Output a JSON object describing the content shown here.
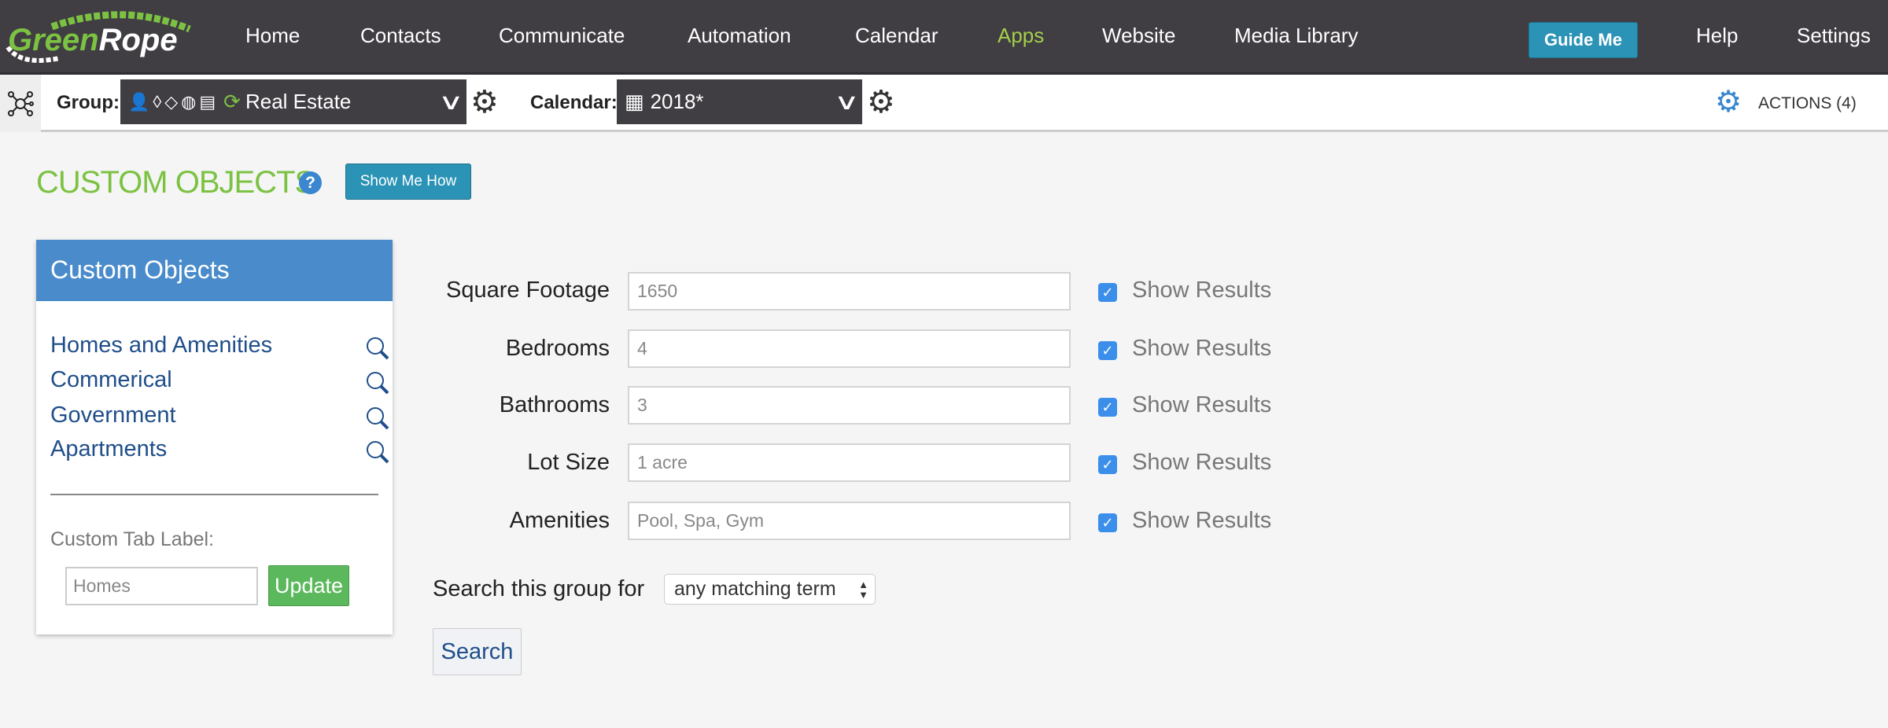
{
  "brand": {
    "logo_text": "GreenRope",
    "accent": "#7cc242"
  },
  "nav": {
    "items": [
      {
        "label": "Home"
      },
      {
        "label": "Contacts"
      },
      {
        "label": "Communicate"
      },
      {
        "label": "Automation"
      },
      {
        "label": "Calendar"
      },
      {
        "label": "Apps",
        "active": true
      },
      {
        "label": "Website"
      },
      {
        "label": "Media Library"
      }
    ],
    "guide_me": "Guide Me",
    "help": "Help",
    "settings": "Settings"
  },
  "toolbar": {
    "group_label": "Group:",
    "group_value": "Real Estate",
    "calendar_label": "Calendar:",
    "calendar_value": "2018*",
    "actions": "ACTIONS (4)"
  },
  "page": {
    "title": "CUSTOM OBJECTS",
    "help_icon": "?",
    "show_me_how": "Show Me How"
  },
  "panel": {
    "title": "Custom Objects",
    "items": [
      {
        "label": "Homes and Amenities"
      },
      {
        "label": "Commerical"
      },
      {
        "label": "Government"
      },
      {
        "label": "Apartments"
      }
    ],
    "tab_label": "Custom Tab Label:",
    "tab_value": "Homes",
    "update": "Update"
  },
  "form": {
    "fields": [
      {
        "label": "Square Footage",
        "value": "1650",
        "show_results": "Show Results",
        "checked": true
      },
      {
        "label": "Bedrooms",
        "value": "4",
        "show_results": "Show Results",
        "checked": true
      },
      {
        "label": "Bathrooms",
        "value": "3",
        "show_results": "Show Results",
        "checked": true
      },
      {
        "label": "Lot Size",
        "value": "1 acre",
        "show_results": "Show Results",
        "checked": true
      },
      {
        "label": "Amenities",
        "value": "Pool, Spa, Gym",
        "show_results": "Show Results",
        "checked": true
      }
    ],
    "search_for_label": "Search this group for",
    "search_mode": "any matching term",
    "search_button": "Search"
  }
}
